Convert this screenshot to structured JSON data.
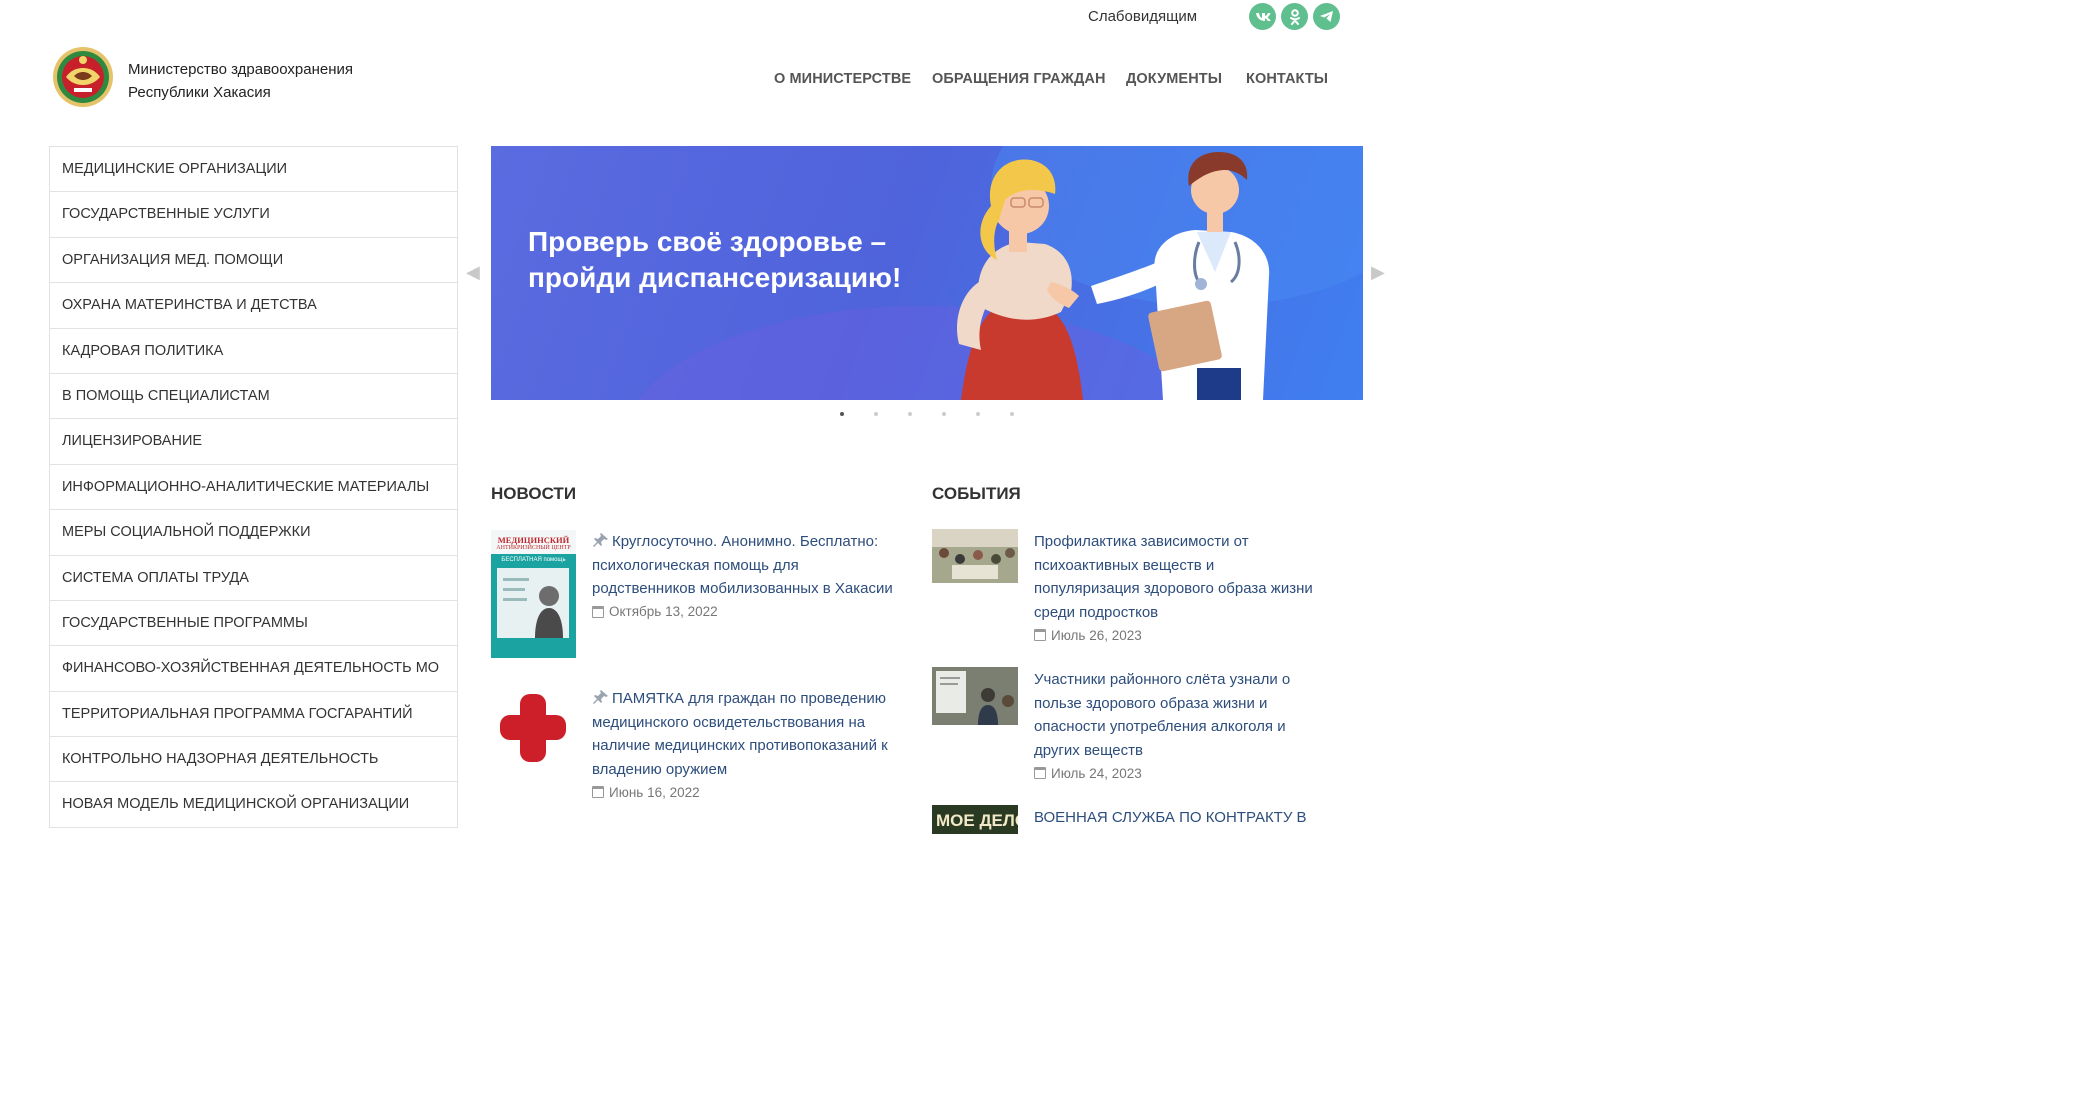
{
  "header": {
    "low_vision_label": "Слабовидящим",
    "social": [
      {
        "name": "vk-icon",
        "glyph": "vk",
        "color": "#5fbf8f"
      },
      {
        "name": "odnoklassniki-icon",
        "glyph": "ok",
        "color": "#5fbf8f"
      },
      {
        "name": "telegram-icon",
        "glyph": "tg",
        "color": "#5fbf8f"
      }
    ],
    "brand_line1": "Министерство здравоохранения",
    "brand_line2": "Республики Хакасия",
    "nav": [
      "О МИНИСТЕРСТВЕ",
      "ОБРАЩЕНИЯ ГРАЖДАН",
      "ДОКУМЕНТЫ",
      "КОНТАКТЫ"
    ]
  },
  "sidebar": {
    "items": [
      "МЕДИЦИНСКИЕ ОРГАНИЗАЦИИ",
      "ГОСУДАРСТВЕННЫЕ УСЛУГИ",
      "ОРГАНИЗАЦИЯ МЕД. ПОМОЩИ",
      "ОХРАНА МАТЕРИНСТВА И ДЕТСТВА",
      "КАДРОВАЯ ПОЛИТИКА",
      "В ПОМОЩЬ СПЕЦИАЛИСТАМ",
      "ЛИЦЕНЗИРОВАНИЕ",
      "ИНФОРМАЦИОННО-АНАЛИТИЧЕСКИЕ МАТЕРИАЛЫ",
      "МЕРЫ СОЦИАЛЬНОЙ ПОДДЕРЖКИ",
      "СИСТЕМА ОПЛАТЫ ТРУДА",
      "ГОСУДАРСТВЕННЫЕ ПРОГРАММЫ",
      "ФИНАНСОВО-ХОЗЯЙСТВЕННАЯ ДЕЯТЕЛЬНОСТЬ МО",
      "ТЕРРИТОРИАЛЬНАЯ ПРОГРАММА ГОСГАРАНТИЙ",
      "КОНТРОЛЬНО НАДЗОРНАЯ ДЕЯТЕЛЬНОСТЬ",
      "НОВАЯ МОДЕЛЬ МЕДИЦИНСКОЙ ОРГАНИЗАЦИИ"
    ]
  },
  "slider": {
    "title_line1": "Проверь своё здоровье –",
    "title_line2": "пройди диспансеризацию!",
    "prev_arrow": "◀",
    "next_arrow": "▶",
    "dot_count": 6,
    "active_dot": 1
  },
  "news": {
    "heading": "НОВОСТИ",
    "items": [
      {
        "title": "Круглосуточно. Анонимно. Бесплатно: психологическая помощь для родственников мобилизованных в Хакасии",
        "date": "Октябрь 13, 2022",
        "pinned": true,
        "thumb_title": "МЕДИЦИНСКИЙ",
        "thumb_subtitle": "АНТИКРИЗИСНЫЙ ЦЕНТР",
        "thumb_band": "БЕСПЛАТНАЯ помощь"
      },
      {
        "title": "ПАМЯТКА для граждан по проведению медицинского освидетельствования на наличие медицинских противопоказаний к владению оружием",
        "date": "Июнь 16, 2022",
        "pinned": true
      }
    ]
  },
  "events": {
    "heading": "СОБЫТИЯ",
    "items": [
      {
        "title": "Профилактика зависимости от психоактивных веществ и популяризация здорового образа жизни среди подростков",
        "date": "Июль 26, 2023"
      },
      {
        "title": "Участники районного слёта узнали о пользе здорового образа жизни и опасности употребления алкоголя и других веществ",
        "date": "Июль 24, 2023"
      },
      {
        "title": "ВОЕННАЯ СЛУЖБА ПО КОНТРАКТУ В",
        "date": "",
        "thumb_text": "МОЕ ДЕЛО"
      }
    ]
  },
  "colors": {
    "link": "#2d4d7c",
    "social": "#5fbf8f",
    "banner_start": "#5b6be0",
    "banner_end": "#3f7ff0",
    "cross_red": "#cc1f2a"
  }
}
